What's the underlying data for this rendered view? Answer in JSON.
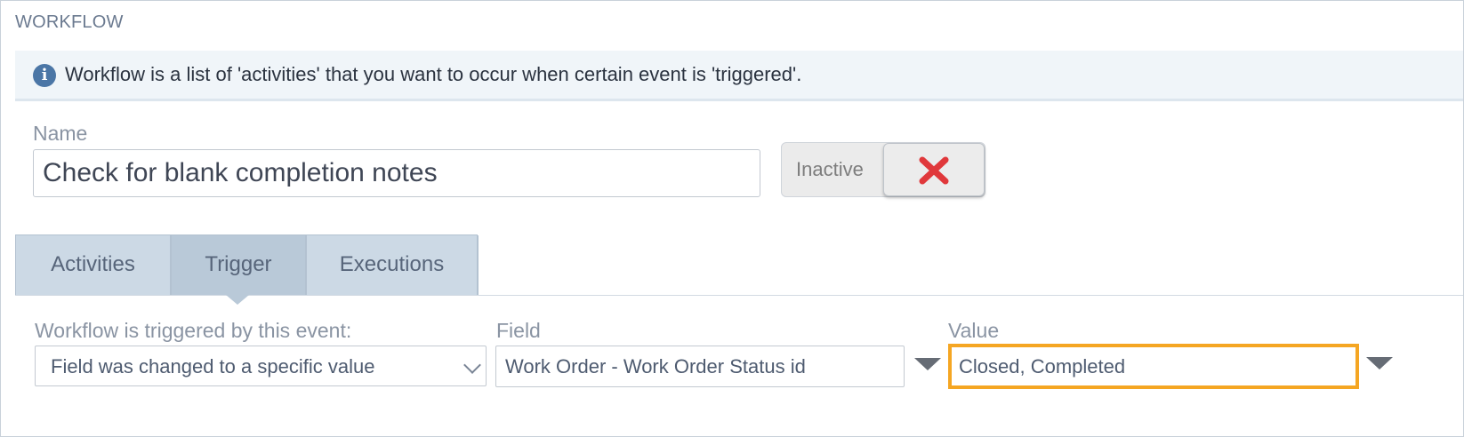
{
  "section_title": "WORKFLOW",
  "info": {
    "icon": "info-icon",
    "text": "Workflow is a list of 'activities' that you want to occur when certain event is 'triggered'."
  },
  "name": {
    "label": "Name",
    "value": "Check for blank completion notes"
  },
  "status_toggle": {
    "label": "Inactive",
    "icon": "close-icon",
    "icon_color": "#e0383b"
  },
  "tabs": [
    {
      "label": "Activities",
      "active": false
    },
    {
      "label": "Trigger",
      "active": true
    },
    {
      "label": "Executions",
      "active": false
    }
  ],
  "trigger": {
    "event_label": "Workflow is triggered by this event:",
    "event_value": "Field was changed to a specific value",
    "field_label": "Field",
    "field_value": "Work Order - Work Order Status id",
    "value_label": "Value",
    "value_value": "Closed, Completed"
  },
  "colors": {
    "highlight": "#f5a623",
    "info_icon": "#4b76a6",
    "tab_background": "#ccd9e5"
  }
}
